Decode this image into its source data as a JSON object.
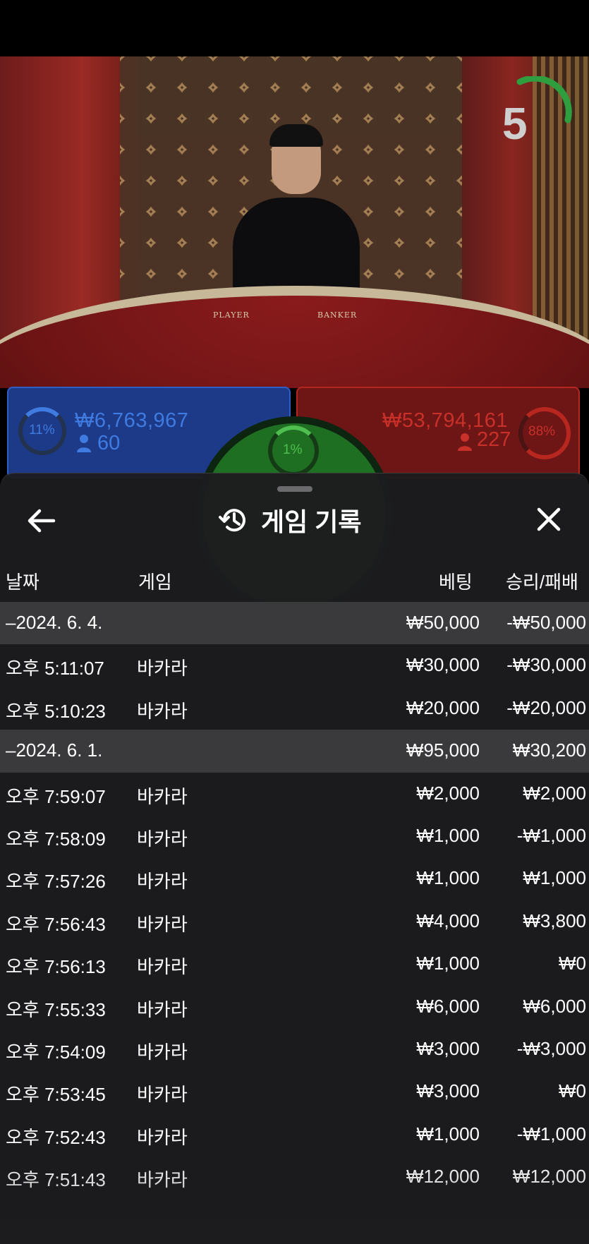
{
  "video": {
    "countdown": "5",
    "table_labels": {
      "player": "PLAYER",
      "banker": "BANKER"
    }
  },
  "bets": {
    "player": {
      "percent": "11%",
      "amount": "₩6,763,967",
      "players": "60"
    },
    "banker": {
      "percent": "88%",
      "amount": "₩53,794,161",
      "players": "227"
    },
    "tie": {
      "percent": "1%"
    }
  },
  "history": {
    "title": "게임 기록",
    "columns": {
      "date": "날짜",
      "game": "게임",
      "bet": "베팅",
      "result": "승리/패배"
    },
    "rows": [
      {
        "type": "group",
        "date": "–2024. 6. 4.",
        "game": "",
        "bet": "₩50,000",
        "result": "-₩50,000"
      },
      {
        "type": "entry",
        "date": "오후 5:11:07",
        "game": "바카라",
        "bet": "₩30,000",
        "result": "-₩30,000"
      },
      {
        "type": "entry",
        "date": "오후 5:10:23",
        "game": "바카라",
        "bet": "₩20,000",
        "result": "-₩20,000"
      },
      {
        "type": "group",
        "date": "–2024. 6. 1.",
        "game": "",
        "bet": "₩95,000",
        "result": "₩30,200"
      },
      {
        "type": "entry",
        "date": "오후 7:59:07",
        "game": "바카라",
        "bet": "₩2,000",
        "result": "₩2,000"
      },
      {
        "type": "entry",
        "date": "오후 7:58:09",
        "game": "바카라",
        "bet": "₩1,000",
        "result": "-₩1,000"
      },
      {
        "type": "entry",
        "date": "오후 7:57:26",
        "game": "바카라",
        "bet": "₩1,000",
        "result": "₩1,000"
      },
      {
        "type": "entry",
        "date": "오후 7:56:43",
        "game": "바카라",
        "bet": "₩4,000",
        "result": "₩3,800"
      },
      {
        "type": "entry",
        "date": "오후 7:56:13",
        "game": "바카라",
        "bet": "₩1,000",
        "result": "₩0"
      },
      {
        "type": "entry",
        "date": "오후 7:55:33",
        "game": "바카라",
        "bet": "₩6,000",
        "result": "₩6,000"
      },
      {
        "type": "entry",
        "date": "오후 7:54:09",
        "game": "바카라",
        "bet": "₩3,000",
        "result": "-₩3,000"
      },
      {
        "type": "entry",
        "date": "오후 7:53:45",
        "game": "바카라",
        "bet": "₩3,000",
        "result": "₩0"
      },
      {
        "type": "entry",
        "date": "오후 7:52:43",
        "game": "바카라",
        "bet": "₩1,000",
        "result": "-₩1,000"
      },
      {
        "type": "entry",
        "date": "오후 7:51:43",
        "game": "바카라",
        "bet": "₩12,000",
        "result": "₩12,000"
      }
    ]
  },
  "colors": {
    "player_blue": "#3f7be0",
    "banker_red": "#c8312a",
    "tie_green": "#4fbf4f",
    "sheet_bg": "#1c1c1e",
    "group_row_bg": "#3a3a3c"
  }
}
